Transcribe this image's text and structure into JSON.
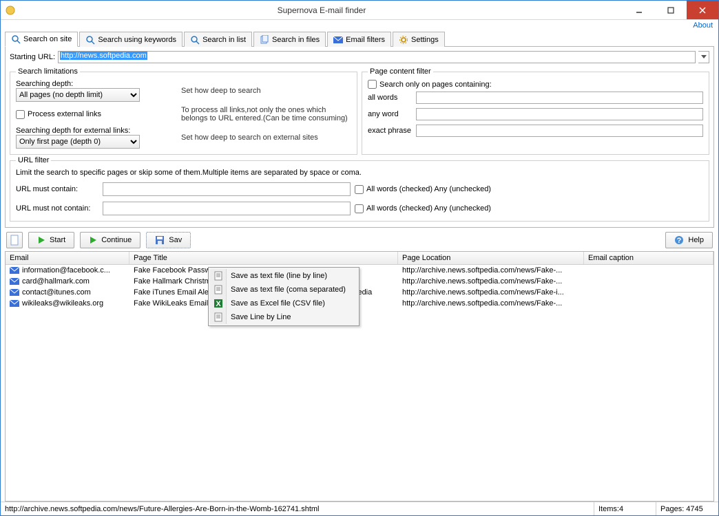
{
  "window": {
    "title": "Supernova E-mail finder"
  },
  "about_link": "About",
  "tabs": [
    {
      "label": "Search on site"
    },
    {
      "label": "Search using keywords"
    },
    {
      "label": "Search in list"
    },
    {
      "label": "Search in files"
    },
    {
      "label": "Email filters"
    },
    {
      "label": "Settings"
    }
  ],
  "starting_url": {
    "label": "Starting URL:",
    "value": "http://news.softpedia.com"
  },
  "limits": {
    "legend": "Search limitations",
    "depth_label": "Searching depth:",
    "depth_value": "All pages (no depth limit)",
    "depth_hint": "Set how deep to search",
    "external_label": "Process external links",
    "external_hint": "To process all links,not only the ones which belongs to URL entered.(Can be time consuming)",
    "external_depth_label": "Searching depth for external links:",
    "external_depth_value": "Only first page (depth 0)",
    "external_depth_hint": "Set how deep to search on external sites"
  },
  "pcf": {
    "legend": "Page content filter",
    "search_only_label": "Search only on pages containing:",
    "all_words_label": "all words",
    "any_word_label": "any word",
    "exact_phrase_label": "exact phrase"
  },
  "url_filter": {
    "legend": "URL filter",
    "desc": "Limit the search to specific pages or skip some of them.Multiple items are separated by space or coma.",
    "must_contain_label": "URL must contain:",
    "must_not_contain_label": "URL must not contain:",
    "checked_label": "All words (checked)  Any (unchecked)"
  },
  "toolbar": {
    "start": "Start",
    "continue": "Continue",
    "save": "Sav",
    "help": "Help"
  },
  "save_menu": [
    "Save as text file (line by line)",
    "Save as text file (coma separated)",
    "Save as Excel file (CSV file)",
    "Save Line by Line"
  ],
  "columns": {
    "email": "Email",
    "title": "Page Title",
    "loc": "Page Location",
    "cap": "Email caption"
  },
  "rows": [
    {
      "email": "information@facebook.c...",
      "title": "Fake Facebook Password",
      "loc": "http://archive.news.softpedia.com/news/Fake-..."
    },
    {
      "email": "card@hallmark.com",
      "title": "Fake Hallmark Christmas C",
      "loc": "http://archive.news.softpedia.com/news/Fake-..."
    },
    {
      "email": "contact@itunes.com",
      "title": "Fake iTunes Email Alerts Lead Users to Drive-By Download - Softpedia",
      "loc": "http://archive.news.softpedia.com/news/Fake-i..."
    },
    {
      "email": "wikileaks@wikileaks.org",
      "title": "Fake WikiLeaks Emails Lead to Backdoor - Softpedia",
      "loc": "http://archive.news.softpedia.com/news/Fake-..."
    }
  ],
  "status": {
    "path": "http://archive.news.softpedia.com/news/Future-Allergies-Are-Born-in-the-Womb-162741.shtml",
    "items": "Items:4",
    "pages": "Pages: 4745"
  }
}
